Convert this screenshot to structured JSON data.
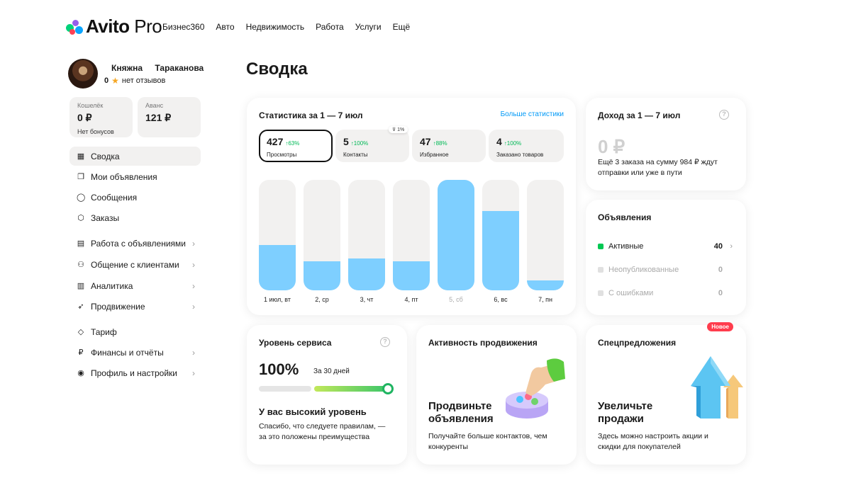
{
  "brand": {
    "name": "Avito",
    "product": "Pro"
  },
  "topnav": [
    "Бизнес360",
    "Авто",
    "Недвижимость",
    "Работа",
    "Услуги",
    "Ещё"
  ],
  "profile": {
    "first_name": "Княжна",
    "last_name": "Тараканова",
    "reviews_count": "0",
    "reviews_text": "нет отзывов"
  },
  "wallet": {
    "label": "Кошелёк",
    "value": "0 ₽",
    "sub": "Нет бонусов"
  },
  "advance": {
    "label": "Аванс",
    "value": "121 ₽"
  },
  "menu": [
    {
      "label": "Сводка",
      "icon": "grid-icon",
      "active": true
    },
    {
      "label": "Мои объявления",
      "icon": "copy-icon"
    },
    {
      "label": "Сообщения",
      "icon": "chat-icon"
    },
    {
      "label": "Заказы",
      "icon": "box-icon"
    },
    {
      "label": "Работа с объявлениями",
      "icon": "document-icon",
      "chevron": true
    },
    {
      "label": "Общение с клиентами",
      "icon": "people-icon",
      "chevron": true
    },
    {
      "label": "Аналитика",
      "icon": "bar-chart-icon",
      "chevron": true
    },
    {
      "label": "Продвижение",
      "icon": "rocket-icon",
      "chevron": true
    },
    {
      "label": "Тариф",
      "icon": "diamond-icon"
    },
    {
      "label": "Финансы и отчёты",
      "icon": "ruble-icon",
      "chevron": true
    },
    {
      "label": "Профиль и настройки",
      "icon": "profile-icon",
      "chevron": true
    }
  ],
  "page_title": "Сводка",
  "stats": {
    "title": "Статистика за 1 — 7 июл",
    "more_link": "Больше статистики",
    "tabs": [
      {
        "value": "427",
        "change": "↑63%",
        "label": "Просмотры",
        "selected": true
      },
      {
        "value": "5",
        "change": "↑100%",
        "label": "Контакты"
      },
      {
        "value": "47",
        "change": "↑88%",
        "label": "Избранное"
      },
      {
        "value": "4",
        "change": "↑100%",
        "label": "Заказано товаров"
      }
    ],
    "filter_badge": "1%",
    "colors": {
      "bar": "#7ecfff",
      "track": "#f2f1f0",
      "growth": "#00b956"
    }
  },
  "chart_data": {
    "type": "bar",
    "categories": [
      "1 июл, вт",
      "2, ср",
      "3, чт",
      "4, пт",
      "5, сб",
      "6, вс",
      "7, пн"
    ],
    "values": [
      0.41,
      0.26,
      0.29,
      0.26,
      1.0,
      0.72,
      0.09
    ],
    "ylim": [
      0,
      1
    ],
    "grid": false
  },
  "income": {
    "title": "Доход за 1 — 7 июл",
    "value": "0 ₽",
    "note": "Ещё 3 заказа на сумму 984 ₽ ждут отправки или уже в пути"
  },
  "ads": {
    "title": "Объявления",
    "rows": [
      {
        "label": "Активные",
        "count": "40",
        "color": "#00c853"
      },
      {
        "label": "Неопубликованные",
        "count": "0",
        "color": "#e0e0e0"
      },
      {
        "label": "С ошибками",
        "count": "0",
        "color": "#e0e0e0"
      }
    ]
  },
  "service": {
    "title": "Уровень сервиса",
    "percent": "100%",
    "level": 1.0,
    "period": "За 30 дней",
    "heading": "У вас высокий уровень",
    "text": "Спасибо, что следуете правилам, — за это положены преимущества"
  },
  "promotion": {
    "title": "Активность продвижения",
    "heading": "Продвиньте объявления",
    "text": "Получайте больше контактов, чем конкуренты"
  },
  "offers": {
    "title": "Спецпредложения",
    "badge": "Новое",
    "heading": "Увеличьте продажи",
    "text": "Здесь можно настроить акции и скидки для покупателей"
  }
}
